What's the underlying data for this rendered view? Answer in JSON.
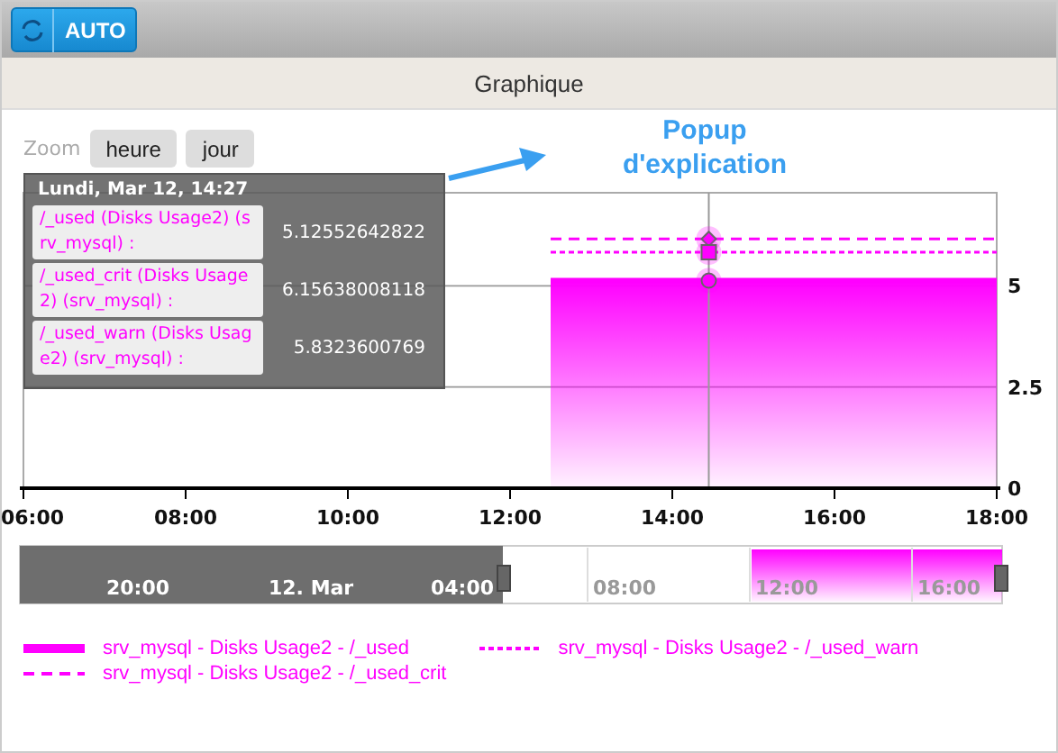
{
  "toolbar": {
    "refresh_label": "AUTO"
  },
  "panel": {
    "title": "Graphique"
  },
  "zoom": {
    "label": "Zoom",
    "buttons": [
      {
        "label": "heure",
        "selected": false
      },
      {
        "label": "jour",
        "selected": false
      }
    ]
  },
  "annotation": {
    "text": "Popup d'explication"
  },
  "tooltip": {
    "title": "Lundi, Mar 12, 14:27",
    "rows": [
      {
        "label": "/_used (Disks Usage2) (srv_mysql) :",
        "value": "5.12552642822"
      },
      {
        "label": "/_used_crit (Disks Usage2) (srv_mysql) :",
        "value": "6.15638008118"
      },
      {
        "label": "/_used_warn (Disks Usage2) (srv_mysql) :",
        "value": "5.8323600769"
      }
    ]
  },
  "chart_data": {
    "type": "area",
    "x": [
      12.5,
      14.45,
      18
    ],
    "xlim": [
      6,
      18
    ],
    "ref_lines": [
      {
        "axis": "x",
        "value": 14.45,
        "color": "#999999"
      }
    ],
    "ylim": [
      0,
      7.3
    ],
    "xticks": [
      {
        "value": 6,
        "label": "06:00"
      },
      {
        "value": 8,
        "label": "08:00"
      },
      {
        "value": 10,
        "label": "10:00"
      },
      {
        "value": 12,
        "label": "12:00"
      },
      {
        "value": 14,
        "label": "14:00"
      },
      {
        "value": 16,
        "label": "16:00"
      },
      {
        "value": 18,
        "label": "18:00"
      }
    ],
    "yticks": [
      {
        "value": 0,
        "label": "0"
      },
      {
        "value": 2.5,
        "label": "2.5"
      },
      {
        "value": 5,
        "label": "5"
      }
    ],
    "series": [
      {
        "name": "srv_mysql - Disks Usage2 - /_used",
        "color": "#ff00ff",
        "type": "area",
        "line_style": "solid",
        "values": [
          5.13,
          5.13,
          5.13
        ]
      },
      {
        "name": "srv_mysql - Disks Usage2 - /_used_crit",
        "color": "#ff00ff",
        "type": "line",
        "line_style": "dashed",
        "values": [
          6.16,
          6.16,
          6.16
        ]
      },
      {
        "name": "srv_mysql - Disks Usage2 - /_used_warn",
        "color": "#ff00ff",
        "type": "line",
        "line_style": "dotted",
        "values": [
          5.83,
          5.83,
          5.83
        ]
      }
    ]
  },
  "navigator": {
    "labels": [
      "20:00",
      "12. Mar",
      "04:00",
      "08:00",
      "12:00",
      "16:00"
    ]
  }
}
